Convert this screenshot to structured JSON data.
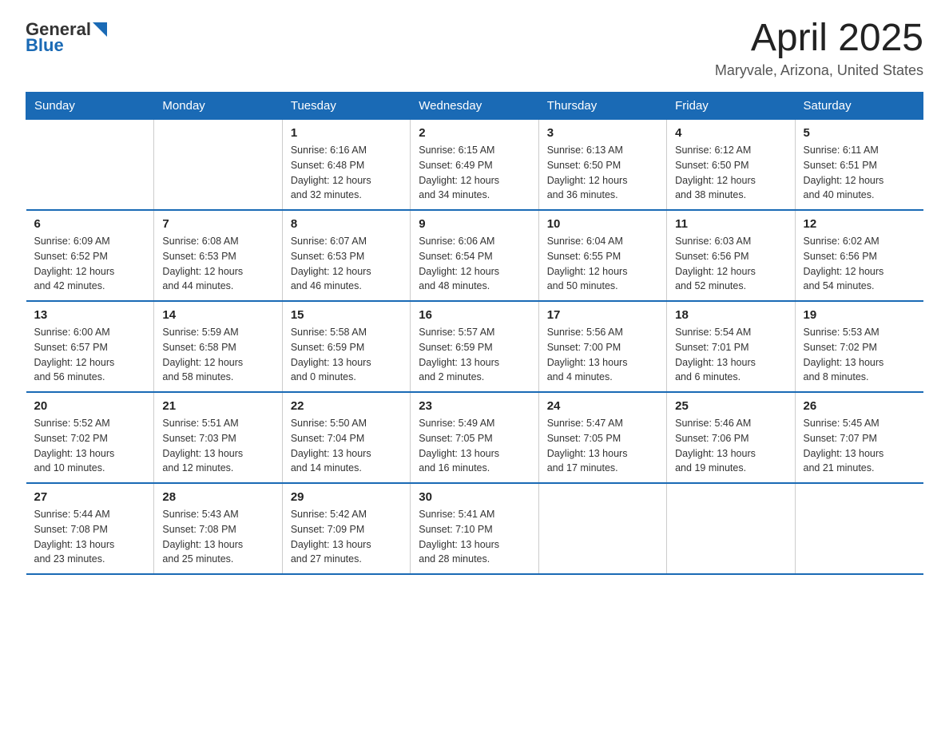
{
  "header": {
    "logo_general": "General",
    "logo_blue": "Blue",
    "month_title": "April 2025",
    "location": "Maryvale, Arizona, United States"
  },
  "days_of_week": [
    "Sunday",
    "Monday",
    "Tuesday",
    "Wednesday",
    "Thursday",
    "Friday",
    "Saturday"
  ],
  "weeks": [
    [
      {
        "day": "",
        "info": ""
      },
      {
        "day": "",
        "info": ""
      },
      {
        "day": "1",
        "info": "Sunrise: 6:16 AM\nSunset: 6:48 PM\nDaylight: 12 hours\nand 32 minutes."
      },
      {
        "day": "2",
        "info": "Sunrise: 6:15 AM\nSunset: 6:49 PM\nDaylight: 12 hours\nand 34 minutes."
      },
      {
        "day": "3",
        "info": "Sunrise: 6:13 AM\nSunset: 6:50 PM\nDaylight: 12 hours\nand 36 minutes."
      },
      {
        "day": "4",
        "info": "Sunrise: 6:12 AM\nSunset: 6:50 PM\nDaylight: 12 hours\nand 38 minutes."
      },
      {
        "day": "5",
        "info": "Sunrise: 6:11 AM\nSunset: 6:51 PM\nDaylight: 12 hours\nand 40 minutes."
      }
    ],
    [
      {
        "day": "6",
        "info": "Sunrise: 6:09 AM\nSunset: 6:52 PM\nDaylight: 12 hours\nand 42 minutes."
      },
      {
        "day": "7",
        "info": "Sunrise: 6:08 AM\nSunset: 6:53 PM\nDaylight: 12 hours\nand 44 minutes."
      },
      {
        "day": "8",
        "info": "Sunrise: 6:07 AM\nSunset: 6:53 PM\nDaylight: 12 hours\nand 46 minutes."
      },
      {
        "day": "9",
        "info": "Sunrise: 6:06 AM\nSunset: 6:54 PM\nDaylight: 12 hours\nand 48 minutes."
      },
      {
        "day": "10",
        "info": "Sunrise: 6:04 AM\nSunset: 6:55 PM\nDaylight: 12 hours\nand 50 minutes."
      },
      {
        "day": "11",
        "info": "Sunrise: 6:03 AM\nSunset: 6:56 PM\nDaylight: 12 hours\nand 52 minutes."
      },
      {
        "day": "12",
        "info": "Sunrise: 6:02 AM\nSunset: 6:56 PM\nDaylight: 12 hours\nand 54 minutes."
      }
    ],
    [
      {
        "day": "13",
        "info": "Sunrise: 6:00 AM\nSunset: 6:57 PM\nDaylight: 12 hours\nand 56 minutes."
      },
      {
        "day": "14",
        "info": "Sunrise: 5:59 AM\nSunset: 6:58 PM\nDaylight: 12 hours\nand 58 minutes."
      },
      {
        "day": "15",
        "info": "Sunrise: 5:58 AM\nSunset: 6:59 PM\nDaylight: 13 hours\nand 0 minutes."
      },
      {
        "day": "16",
        "info": "Sunrise: 5:57 AM\nSunset: 6:59 PM\nDaylight: 13 hours\nand 2 minutes."
      },
      {
        "day": "17",
        "info": "Sunrise: 5:56 AM\nSunset: 7:00 PM\nDaylight: 13 hours\nand 4 minutes."
      },
      {
        "day": "18",
        "info": "Sunrise: 5:54 AM\nSunset: 7:01 PM\nDaylight: 13 hours\nand 6 minutes."
      },
      {
        "day": "19",
        "info": "Sunrise: 5:53 AM\nSunset: 7:02 PM\nDaylight: 13 hours\nand 8 minutes."
      }
    ],
    [
      {
        "day": "20",
        "info": "Sunrise: 5:52 AM\nSunset: 7:02 PM\nDaylight: 13 hours\nand 10 minutes."
      },
      {
        "day": "21",
        "info": "Sunrise: 5:51 AM\nSunset: 7:03 PM\nDaylight: 13 hours\nand 12 minutes."
      },
      {
        "day": "22",
        "info": "Sunrise: 5:50 AM\nSunset: 7:04 PM\nDaylight: 13 hours\nand 14 minutes."
      },
      {
        "day": "23",
        "info": "Sunrise: 5:49 AM\nSunset: 7:05 PM\nDaylight: 13 hours\nand 16 minutes."
      },
      {
        "day": "24",
        "info": "Sunrise: 5:47 AM\nSunset: 7:05 PM\nDaylight: 13 hours\nand 17 minutes."
      },
      {
        "day": "25",
        "info": "Sunrise: 5:46 AM\nSunset: 7:06 PM\nDaylight: 13 hours\nand 19 minutes."
      },
      {
        "day": "26",
        "info": "Sunrise: 5:45 AM\nSunset: 7:07 PM\nDaylight: 13 hours\nand 21 minutes."
      }
    ],
    [
      {
        "day": "27",
        "info": "Sunrise: 5:44 AM\nSunset: 7:08 PM\nDaylight: 13 hours\nand 23 minutes."
      },
      {
        "day": "28",
        "info": "Sunrise: 5:43 AM\nSunset: 7:08 PM\nDaylight: 13 hours\nand 25 minutes."
      },
      {
        "day": "29",
        "info": "Sunrise: 5:42 AM\nSunset: 7:09 PM\nDaylight: 13 hours\nand 27 minutes."
      },
      {
        "day": "30",
        "info": "Sunrise: 5:41 AM\nSunset: 7:10 PM\nDaylight: 13 hours\nand 28 minutes."
      },
      {
        "day": "",
        "info": ""
      },
      {
        "day": "",
        "info": ""
      },
      {
        "day": "",
        "info": ""
      }
    ]
  ]
}
